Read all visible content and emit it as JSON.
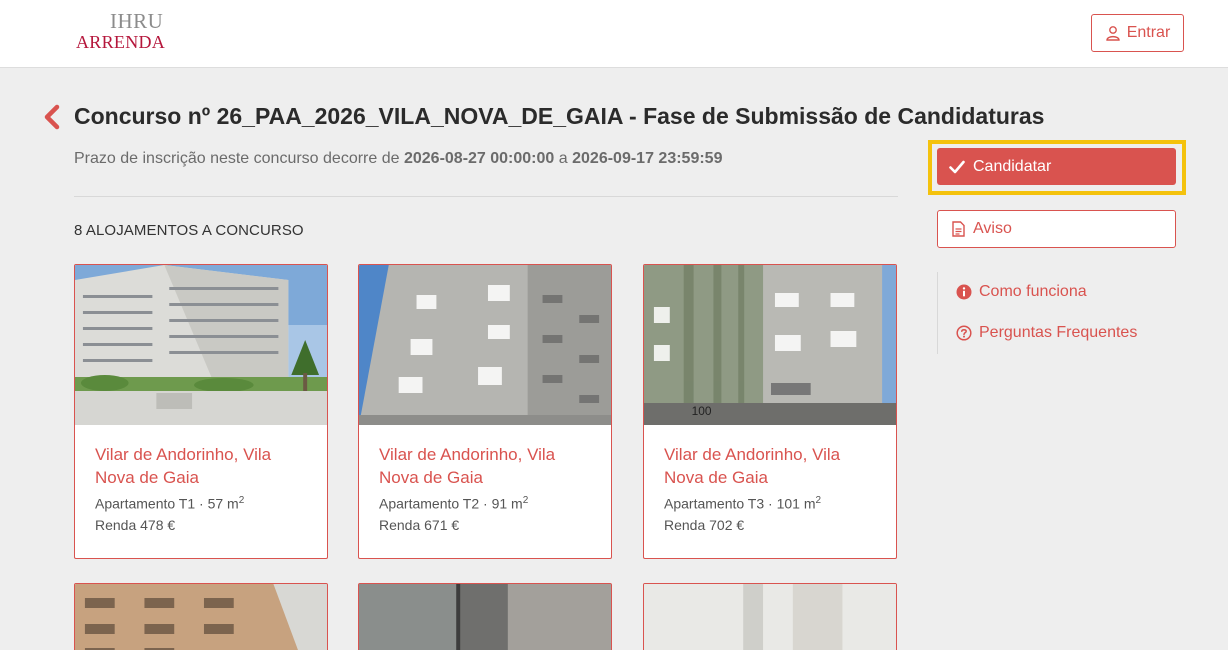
{
  "header": {
    "logo_line1": "IHRU",
    "logo_line2": "ARRENDA",
    "login_label": "Entrar"
  },
  "contest": {
    "title": "Concurso nº 26_PAA_2026_VILA_NOVA_DE_GAIA - Fase de Submissão de Candidaturas",
    "period_prefix": "Prazo de inscrição neste concurso decorre de",
    "period_start": "2026-08-27 00:00:00",
    "period_joiner": "a",
    "period_end": "2026-09-17 23:59:59",
    "listing_count_label": "8 ALOJAMENTOS A CONCURSO"
  },
  "listings": [
    {
      "location": "Vilar de Andorinho, Vila Nova de Gaia",
      "type": "Apartamento T1 · 57 m",
      "rent": "Renda 478 €"
    },
    {
      "location": "Vilar de Andorinho, Vila Nova de Gaia",
      "type": "Apartamento T2 · 91 m",
      "rent": "Renda 671 €"
    },
    {
      "location": "Vilar de Andorinho, Vila Nova de Gaia",
      "type": "Apartamento T3 · 101 m",
      "rent": "Renda 702 €"
    }
  ],
  "sidebar": {
    "apply_label": "Candidatar",
    "notice_label": "Aviso",
    "how_it_works_label": "Como funciona",
    "faq_label": "Perguntas Frequentes"
  },
  "colors": {
    "accent": "#d9534f",
    "brand": "#b5163b",
    "highlight": "#f4c20d",
    "background": "#eeeeee"
  }
}
